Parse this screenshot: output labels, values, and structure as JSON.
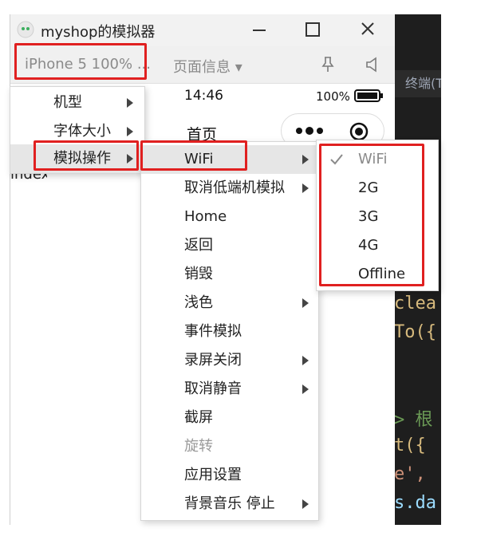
{
  "window": {
    "title": "myshop的模拟器"
  },
  "toolbar": {
    "device_label": "iPhone 5 100% ...",
    "page_info_label": "页面信息 ▾"
  },
  "phone": {
    "time": "14:46",
    "battery_pct": "100%",
    "nav_title": "首页",
    "body_text": "index"
  },
  "editor": {
    "tab_label": "终端(T",
    "code_lines": [
      "clea",
      "To({",
      "> 根",
      "t({",
      "e',",
      "s.da"
    ]
  },
  "menu1": {
    "items": [
      {
        "label": "机型",
        "submenu": true
      },
      {
        "label": "字体大小",
        "submenu": true
      },
      {
        "label": "模拟操作",
        "submenu": true
      }
    ]
  },
  "menu2": {
    "items": [
      {
        "label": "WiFi",
        "submenu": true
      },
      {
        "label": "取消低端机模拟",
        "submenu": true
      },
      {
        "label": "Home",
        "submenu": false
      },
      {
        "label": "返回",
        "submenu": false
      },
      {
        "label": "销毁",
        "submenu": false
      },
      {
        "label": "浅色",
        "submenu": true
      },
      {
        "label": "事件模拟",
        "submenu": false
      },
      {
        "label": "录屏关闭",
        "submenu": true
      },
      {
        "label": "取消静音",
        "submenu": true
      },
      {
        "label": "截屏",
        "submenu": false
      },
      {
        "label": "旋转",
        "submenu": false,
        "disabled": true
      },
      {
        "label": "应用设置",
        "submenu": false
      },
      {
        "label": "背景音乐 停止",
        "submenu": true
      }
    ]
  },
  "menu3": {
    "selected": "WiFi",
    "items": [
      "WiFi",
      "2G",
      "3G",
      "4G",
      "Offline"
    ]
  },
  "colors": {
    "highlight_box": "#e02020",
    "editor_bg": "#1e1e1e"
  }
}
